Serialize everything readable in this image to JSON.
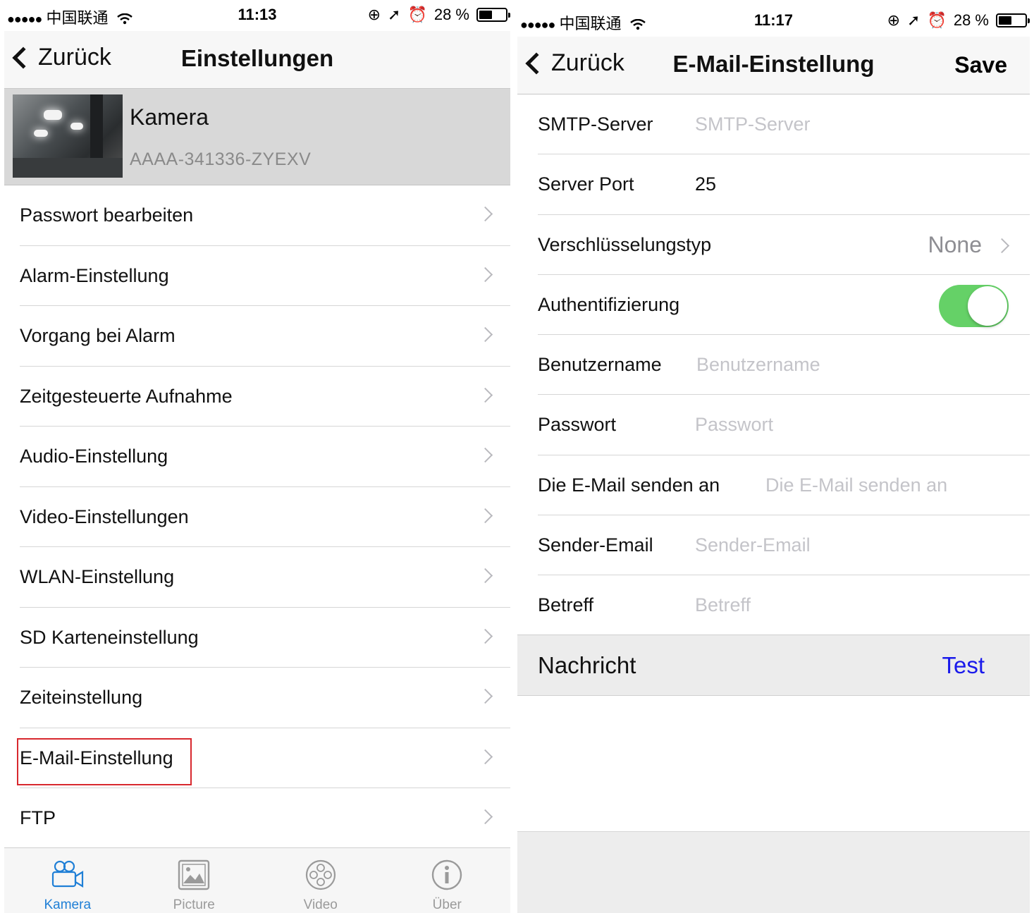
{
  "left": {
    "status": {
      "carrier": "中国联通",
      "time": "11:13",
      "battery": "28 %",
      "battery_level": 0.28
    },
    "nav": {
      "back": "Zurück",
      "title": "Einstellungen"
    },
    "camera": {
      "name": "Kamera",
      "id": "AAAA-341336-ZYEXV"
    },
    "menu": [
      {
        "label": "Passwort bearbeiten"
      },
      {
        "label": "Alarm-Einstellung"
      },
      {
        "label": "Vorgang bei Alarm"
      },
      {
        "label": "Zeitgesteuerte Aufnahme"
      },
      {
        "label": "Audio-Einstellung"
      },
      {
        "label": "Video-Einstellungen"
      },
      {
        "label": "WLAN-Einstellung"
      },
      {
        "label": "SD Karteneinstellung"
      },
      {
        "label": "Zeiteinstellung"
      },
      {
        "label": "E-Mail-Einstellung",
        "highlighted": true
      },
      {
        "label": "FTP"
      }
    ],
    "tabs": [
      {
        "label": "Kamera",
        "icon": "camera-icon",
        "active": true
      },
      {
        "label": "Picture",
        "icon": "picture-icon"
      },
      {
        "label": "Video",
        "icon": "film-reel-icon"
      },
      {
        "label": "Über",
        "icon": "info-icon"
      }
    ],
    "colors": {
      "active_tab": "#1f7fd6",
      "highlight_border": "#d8282e"
    }
  },
  "right": {
    "status": {
      "carrier": "中国联通",
      "time": "11:17",
      "battery": "28 %",
      "battery_level": 0.28
    },
    "nav": {
      "back": "Zurück",
      "title": "E-Mail-Einstellung",
      "save": "Save"
    },
    "form": {
      "smtp_server": {
        "label": "SMTP-Server",
        "placeholder": "SMTP-Server",
        "value": ""
      },
      "server_port": {
        "label": "Server Port",
        "value": "25"
      },
      "encryption": {
        "label": "Verschlüsselungstyp",
        "value": "None"
      },
      "authentication": {
        "label": "Authentifizierung",
        "enabled": true
      },
      "username": {
        "label": "Benutzername",
        "placeholder": "Benutzername",
        "value": ""
      },
      "password": {
        "label": "Passwort",
        "placeholder": "Passwort",
        "value": ""
      },
      "send_to": {
        "label": "Die E-Mail senden an",
        "placeholder": "Die E-Mail senden an",
        "value": ""
      },
      "sender": {
        "label": "Sender-Email",
        "placeholder": "Sender-Email",
        "value": ""
      },
      "subject": {
        "label": "Betreff",
        "placeholder": "Betreff",
        "value": ""
      }
    },
    "message": {
      "label": "Nachricht",
      "test": "Test"
    },
    "colors": {
      "toggle_on": "#65d167",
      "test_link": "#1a1aeb"
    }
  }
}
